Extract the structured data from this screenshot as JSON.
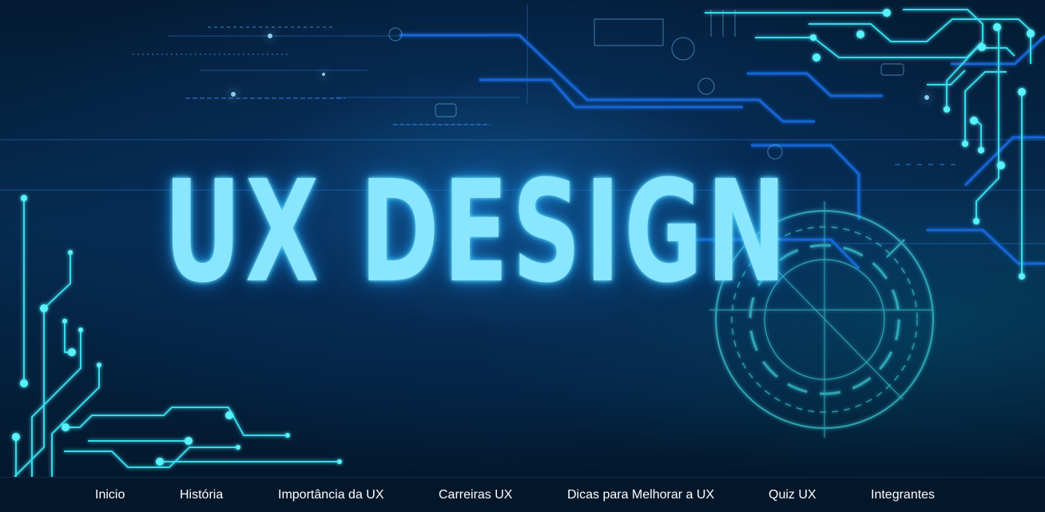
{
  "hero": {
    "title": "UX DESIGN"
  },
  "nav": {
    "items": [
      "Inicio",
      "História",
      "Importância da UX",
      "Carreiras UX",
      "Dicas para Melhorar a UX",
      "Quiz UX",
      "Integrantes"
    ]
  }
}
